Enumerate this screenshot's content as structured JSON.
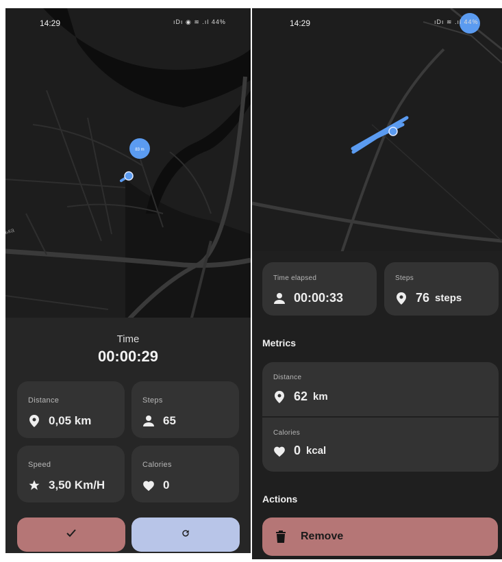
{
  "left": {
    "status": {
      "time": "14:29",
      "icons": "ıDı ◉ ≋ .ıl 44%"
    },
    "map": {
      "distance_badge": "83 m",
      "street_label": "ька"
    },
    "time_label": "Time",
    "time_value": "00:00:29",
    "cards": {
      "distance": {
        "label": "Distance",
        "value": "0,05 km",
        "icon": "location-pin-icon"
      },
      "steps": {
        "label": "Steps",
        "value": "65",
        "icon": "person-icon"
      },
      "speed": {
        "label": "Speed",
        "value": "3,50 Km/H",
        "icon": "star-icon"
      },
      "calories": {
        "label": "Calories",
        "value": "0",
        "icon": "heart-icon"
      }
    },
    "buttons": {
      "finish": {
        "icon": "checkmark-icon",
        "color": "#b57676"
      },
      "reset": {
        "icon": "refresh-icon",
        "color": "#b8c5e8"
      }
    }
  },
  "right": {
    "status": {
      "time": "14:29",
      "icons": "ıDı ≋ .ıl 44%"
    },
    "cards": {
      "time_elapsed": {
        "label": "Time elapsed",
        "value": "00:00:33",
        "icon": "person-icon"
      },
      "steps": {
        "label": "Steps",
        "value": "76",
        "unit": "steps",
        "icon": "location-pin-icon"
      }
    },
    "metrics_title": "Metrics",
    "metrics": {
      "distance": {
        "label": "Distance",
        "value": "62",
        "unit": "km",
        "icon": "location-pin-icon"
      },
      "calories": {
        "label": "Calories",
        "value": "0",
        "unit": "kcal",
        "icon": "heart-icon"
      }
    },
    "actions_title": "Actions",
    "remove_label": "Remove"
  },
  "colors": {
    "accent_route": "#5b9bf0",
    "panel_bg": "#262626",
    "card_bg": "#333333",
    "map_bg": "#1c1c1c"
  }
}
